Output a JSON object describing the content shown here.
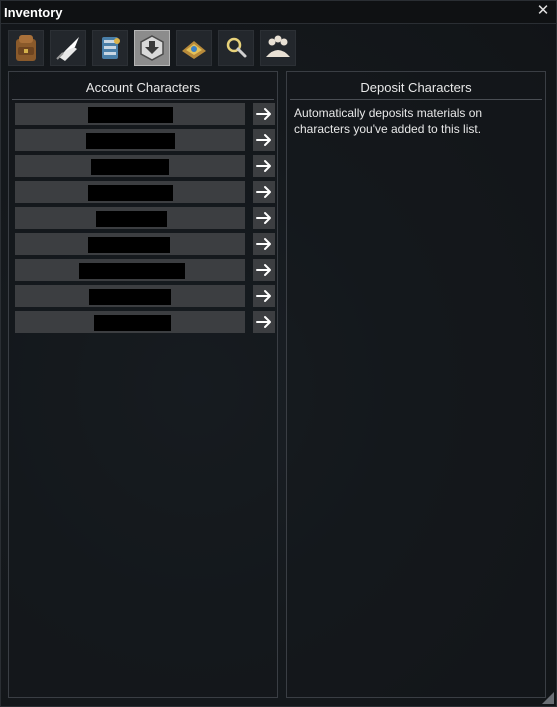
{
  "window": {
    "title": "Inventory"
  },
  "tabs": [
    {
      "icon": "backpack-icon",
      "active": false
    },
    {
      "icon": "quill-page-icon",
      "active": false
    },
    {
      "icon": "crafting-scroll-icon",
      "active": false
    },
    {
      "icon": "deposit-down-icon",
      "active": true
    },
    {
      "icon": "bank-chest-icon",
      "active": false
    },
    {
      "icon": "magnifier-icon",
      "active": false
    },
    {
      "icon": "guild-members-icon",
      "active": false
    }
  ],
  "account_panel": {
    "title": "Account Characters",
    "rows": [
      {
        "name": "[redacted]",
        "action_icon": "arrow-right-icon"
      },
      {
        "name": "[redacted]",
        "action_icon": "arrow-right-icon"
      },
      {
        "name": "[redacted]",
        "action_icon": "arrow-right-icon"
      },
      {
        "name": "[redacted]",
        "action_icon": "arrow-right-icon"
      },
      {
        "name": "[redacted]",
        "action_icon": "arrow-right-icon"
      },
      {
        "name": "[redacted]",
        "action_icon": "arrow-right-icon"
      },
      {
        "name": "[redacted]",
        "action_icon": "arrow-right-icon"
      },
      {
        "name": "[redacted]",
        "action_icon": "arrow-right-icon"
      },
      {
        "name": "[redacted]",
        "action_icon": "arrow-right-icon"
      }
    ]
  },
  "deposit_panel": {
    "title": "Deposit Characters",
    "description": "Automatically deposits materials on characters you've added to this list."
  },
  "colors": {
    "window_bg": "#15191d",
    "row_bg": "#3c3e41",
    "active_tab": "#8c8c8c",
    "text": "#e8e8e8"
  }
}
